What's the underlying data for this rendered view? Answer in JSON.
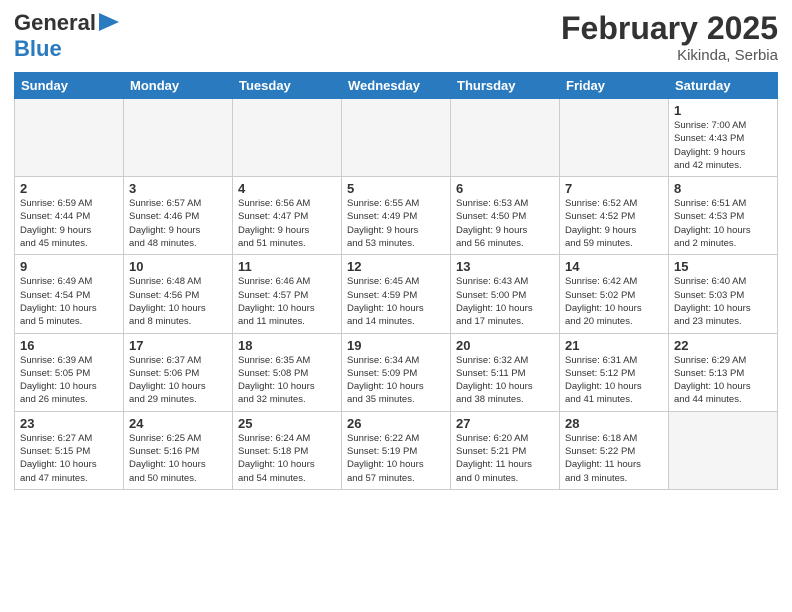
{
  "header": {
    "logo_general": "General",
    "logo_blue": "Blue",
    "month_title": "February 2025",
    "location": "Kikinda, Serbia"
  },
  "calendar": {
    "days_of_week": [
      "Sunday",
      "Monday",
      "Tuesday",
      "Wednesday",
      "Thursday",
      "Friday",
      "Saturday"
    ],
    "weeks": [
      [
        {
          "day": "",
          "info": ""
        },
        {
          "day": "",
          "info": ""
        },
        {
          "day": "",
          "info": ""
        },
        {
          "day": "",
          "info": ""
        },
        {
          "day": "",
          "info": ""
        },
        {
          "day": "",
          "info": ""
        },
        {
          "day": "1",
          "info": "Sunrise: 7:00 AM\nSunset: 4:43 PM\nDaylight: 9 hours\nand 42 minutes."
        }
      ],
      [
        {
          "day": "2",
          "info": "Sunrise: 6:59 AM\nSunset: 4:44 PM\nDaylight: 9 hours\nand 45 minutes."
        },
        {
          "day": "3",
          "info": "Sunrise: 6:57 AM\nSunset: 4:46 PM\nDaylight: 9 hours\nand 48 minutes."
        },
        {
          "day": "4",
          "info": "Sunrise: 6:56 AM\nSunset: 4:47 PM\nDaylight: 9 hours\nand 51 minutes."
        },
        {
          "day": "5",
          "info": "Sunrise: 6:55 AM\nSunset: 4:49 PM\nDaylight: 9 hours\nand 53 minutes."
        },
        {
          "day": "6",
          "info": "Sunrise: 6:53 AM\nSunset: 4:50 PM\nDaylight: 9 hours\nand 56 minutes."
        },
        {
          "day": "7",
          "info": "Sunrise: 6:52 AM\nSunset: 4:52 PM\nDaylight: 9 hours\nand 59 minutes."
        },
        {
          "day": "8",
          "info": "Sunrise: 6:51 AM\nSunset: 4:53 PM\nDaylight: 10 hours\nand 2 minutes."
        }
      ],
      [
        {
          "day": "9",
          "info": "Sunrise: 6:49 AM\nSunset: 4:54 PM\nDaylight: 10 hours\nand 5 minutes."
        },
        {
          "day": "10",
          "info": "Sunrise: 6:48 AM\nSunset: 4:56 PM\nDaylight: 10 hours\nand 8 minutes."
        },
        {
          "day": "11",
          "info": "Sunrise: 6:46 AM\nSunset: 4:57 PM\nDaylight: 10 hours\nand 11 minutes."
        },
        {
          "day": "12",
          "info": "Sunrise: 6:45 AM\nSunset: 4:59 PM\nDaylight: 10 hours\nand 14 minutes."
        },
        {
          "day": "13",
          "info": "Sunrise: 6:43 AM\nSunset: 5:00 PM\nDaylight: 10 hours\nand 17 minutes."
        },
        {
          "day": "14",
          "info": "Sunrise: 6:42 AM\nSunset: 5:02 PM\nDaylight: 10 hours\nand 20 minutes."
        },
        {
          "day": "15",
          "info": "Sunrise: 6:40 AM\nSunset: 5:03 PM\nDaylight: 10 hours\nand 23 minutes."
        }
      ],
      [
        {
          "day": "16",
          "info": "Sunrise: 6:39 AM\nSunset: 5:05 PM\nDaylight: 10 hours\nand 26 minutes."
        },
        {
          "day": "17",
          "info": "Sunrise: 6:37 AM\nSunset: 5:06 PM\nDaylight: 10 hours\nand 29 minutes."
        },
        {
          "day": "18",
          "info": "Sunrise: 6:35 AM\nSunset: 5:08 PM\nDaylight: 10 hours\nand 32 minutes."
        },
        {
          "day": "19",
          "info": "Sunrise: 6:34 AM\nSunset: 5:09 PM\nDaylight: 10 hours\nand 35 minutes."
        },
        {
          "day": "20",
          "info": "Sunrise: 6:32 AM\nSunset: 5:11 PM\nDaylight: 10 hours\nand 38 minutes."
        },
        {
          "day": "21",
          "info": "Sunrise: 6:31 AM\nSunset: 5:12 PM\nDaylight: 10 hours\nand 41 minutes."
        },
        {
          "day": "22",
          "info": "Sunrise: 6:29 AM\nSunset: 5:13 PM\nDaylight: 10 hours\nand 44 minutes."
        }
      ],
      [
        {
          "day": "23",
          "info": "Sunrise: 6:27 AM\nSunset: 5:15 PM\nDaylight: 10 hours\nand 47 minutes."
        },
        {
          "day": "24",
          "info": "Sunrise: 6:25 AM\nSunset: 5:16 PM\nDaylight: 10 hours\nand 50 minutes."
        },
        {
          "day": "25",
          "info": "Sunrise: 6:24 AM\nSunset: 5:18 PM\nDaylight: 10 hours\nand 54 minutes."
        },
        {
          "day": "26",
          "info": "Sunrise: 6:22 AM\nSunset: 5:19 PM\nDaylight: 10 hours\nand 57 minutes."
        },
        {
          "day": "27",
          "info": "Sunrise: 6:20 AM\nSunset: 5:21 PM\nDaylight: 11 hours\nand 0 minutes."
        },
        {
          "day": "28",
          "info": "Sunrise: 6:18 AM\nSunset: 5:22 PM\nDaylight: 11 hours\nand 3 minutes."
        },
        {
          "day": "",
          "info": ""
        }
      ]
    ]
  }
}
